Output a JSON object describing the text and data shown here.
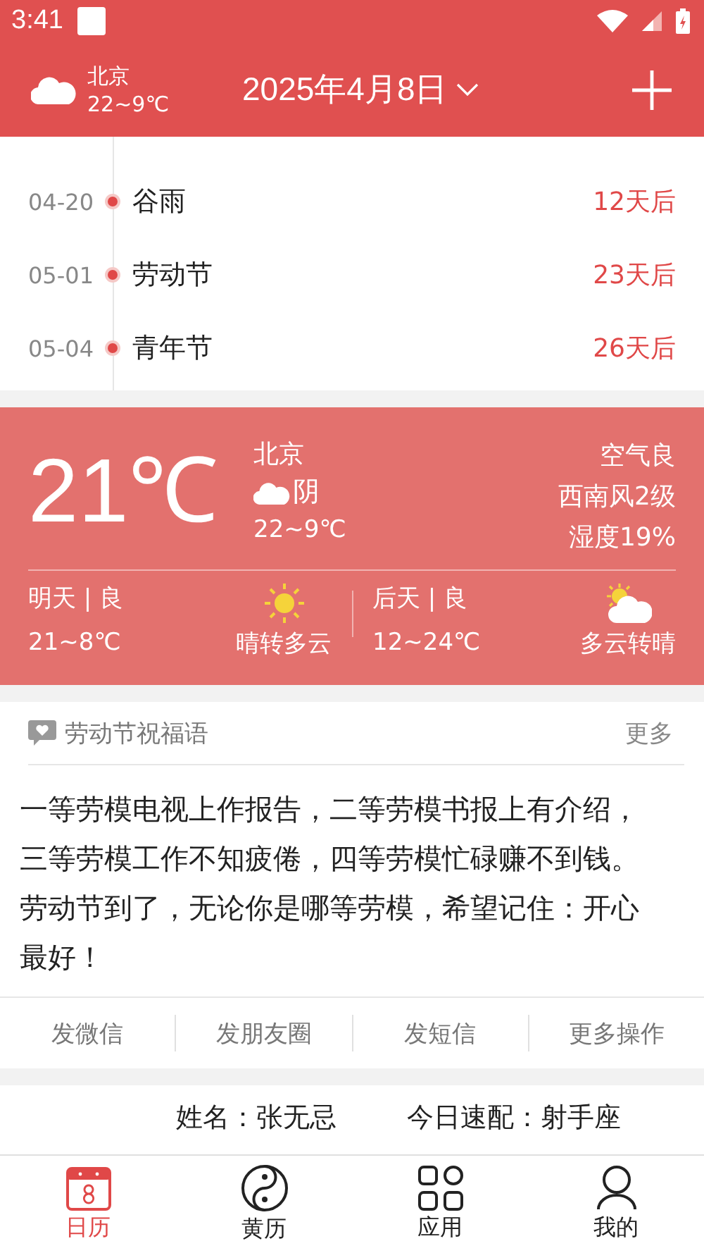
{
  "status_bar": {
    "time": "3:41"
  },
  "header": {
    "city": "北京",
    "temp_range": "22~9℃",
    "date": "2025年4月8日"
  },
  "festivals": [
    {
      "date": "04-20",
      "name": "谷雨",
      "countdown": "12天后"
    },
    {
      "date": "05-01",
      "name": "劳动节",
      "countdown": "23天后"
    },
    {
      "date": "05-04",
      "name": "青年节",
      "countdown": "26天后"
    }
  ],
  "weather": {
    "temperature": "21℃",
    "city": "北京",
    "condition": "阴",
    "temp_range": "22~9℃",
    "air": "空气良",
    "wind": "西南风2级",
    "humidity": "湿度19%",
    "forecast": [
      {
        "day": "明天 | 良",
        "temp_range": "21~8℃",
        "condition": "晴转多云",
        "kind": "sun"
      },
      {
        "day": "后天 | 良",
        "temp_range": "12~24℃",
        "condition": "多云转晴",
        "kind": "partly-cloudy"
      }
    ]
  },
  "blessing": {
    "title": "劳动节祝福语",
    "more": "更多",
    "text": "一等劳模电视上作报告，二等劳模书报上有介绍，三等劳模工作不知疲倦，四等劳模忙碌赚不到钱。劳动节到了，无论你是哪等劳模，希望记住：开心最好！",
    "actions": [
      "发微信",
      "发朋友圈",
      "发短信",
      "更多操作"
    ]
  },
  "profile": {
    "name": "姓名：张无忌",
    "match": "今日速配：射手座"
  },
  "bottom_nav": [
    {
      "label": "日历",
      "selected": true
    },
    {
      "label": "黄历",
      "selected": false
    },
    {
      "label": "应用",
      "selected": false
    },
    {
      "label": "我的",
      "selected": false
    }
  ]
}
